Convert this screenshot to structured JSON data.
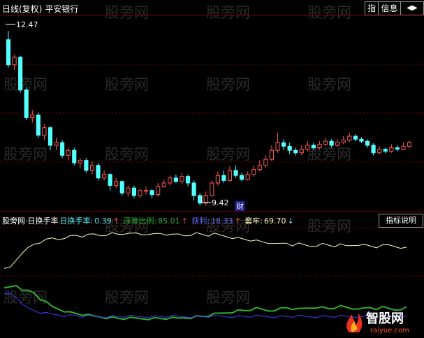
{
  "header": {
    "period": "日线(复权)",
    "stock": "平安银行",
    "btn_zhi": "指",
    "btn_info": "信息",
    "btn_arrows": "◀▶"
  },
  "watermark": "股旁网",
  "price_labels": {
    "high": "12.47",
    "low": "9.42"
  },
  "event_marker": "财",
  "indicator": {
    "name": "股旁网·日换手率",
    "turnover_label": "日换手率:",
    "turnover_value": "0.39",
    "float_label": "浮筹比例:",
    "float_value": "85.01",
    "profit_label": "获利:",
    "profit_value": "18.33",
    "trapped_label": "套牢:",
    "trapped_value": "69.70",
    "desc_button": "指标说明"
  },
  "colors": {
    "up": "#ff5a5a",
    "down": "#54ffff",
    "yellow": "#fffcbf",
    "green": "#2fae2f",
    "blue": "#3d3dff",
    "grid": "#7a0000",
    "white": "#ffffff"
  },
  "logo": {
    "text": "智股网",
    "url": "raiyue.com"
  },
  "chart_data": [
    {
      "type": "candlestick",
      "labels": {
        "high": "12.47",
        "low": "9.42"
      },
      "ylim": [
        9.2,
        12.7
      ],
      "candles": [
        [
          12.3,
          11.8,
          12.47,
          11.75
        ],
        [
          11.8,
          11.95,
          12.0,
          11.7
        ],
        [
          11.95,
          11.3,
          11.98,
          11.25
        ],
        [
          11.3,
          10.75,
          11.35,
          10.7
        ],
        [
          10.75,
          10.8,
          10.9,
          10.65
        ],
        [
          10.8,
          10.4,
          10.85,
          10.35
        ],
        [
          10.4,
          10.55,
          10.62,
          10.3
        ],
        [
          10.55,
          10.2,
          10.58,
          10.1
        ],
        [
          10.2,
          10.25,
          10.35,
          10.1
        ],
        [
          10.25,
          10.0,
          10.3,
          9.95
        ],
        [
          10.0,
          10.1,
          10.15,
          9.9
        ],
        [
          10.1,
          9.85,
          10.15,
          9.8
        ],
        [
          9.85,
          9.9,
          9.95,
          9.75
        ],
        [
          9.9,
          9.7,
          9.95,
          9.65
        ],
        [
          9.7,
          9.8,
          9.88,
          9.62
        ],
        [
          9.8,
          9.55,
          9.85,
          9.5
        ],
        [
          9.55,
          9.62,
          9.7,
          9.5
        ],
        [
          9.62,
          9.4,
          9.65,
          9.3
        ],
        [
          9.4,
          9.48,
          9.55,
          9.35
        ],
        [
          9.48,
          9.25,
          9.5,
          9.2
        ],
        [
          9.25,
          9.35,
          9.4,
          9.18
        ],
        [
          9.35,
          9.2,
          9.4,
          9.15
        ],
        [
          9.2,
          9.3,
          9.35,
          9.15
        ],
        [
          9.3,
          9.3,
          9.38,
          9.22
        ],
        [
          9.3,
          9.22,
          9.33,
          9.15
        ],
        [
          9.22,
          9.38,
          9.45,
          9.18
        ],
        [
          9.38,
          9.45,
          9.52,
          9.35
        ],
        [
          9.45,
          9.55,
          9.6,
          9.4
        ],
        [
          9.55,
          9.48,
          9.62,
          9.45
        ],
        [
          9.48,
          9.58,
          9.65,
          9.42
        ],
        [
          9.58,
          9.45,
          9.62,
          9.38
        ],
        [
          9.45,
          9.2,
          9.5,
          9.1
        ],
        [
          9.2,
          9.05,
          9.25,
          9.0
        ],
        [
          9.05,
          9.2,
          9.28,
          9.0
        ],
        [
          9.2,
          9.45,
          9.5,
          9.18
        ],
        [
          9.45,
          9.6,
          9.68,
          9.4
        ],
        [
          9.6,
          9.5,
          9.7,
          9.45
        ],
        [
          9.5,
          9.7,
          9.78,
          9.48
        ],
        [
          9.7,
          9.6,
          9.8,
          9.55
        ],
        [
          9.6,
          9.52,
          9.65,
          9.48
        ],
        [
          9.52,
          9.62,
          9.68,
          9.5
        ],
        [
          9.62,
          9.72,
          9.8,
          9.58
        ],
        [
          9.72,
          9.8,
          9.9,
          9.68
        ],
        [
          9.8,
          9.92,
          10.0,
          9.75
        ],
        [
          9.92,
          10.1,
          10.2,
          9.88
        ],
        [
          10.1,
          10.25,
          10.45,
          10.05
        ],
        [
          10.25,
          10.18,
          10.32,
          10.1
        ],
        [
          10.18,
          10.1,
          10.25,
          10.02
        ],
        [
          10.1,
          10.05,
          10.15,
          10.0
        ],
        [
          10.05,
          10.12,
          10.2,
          10.0
        ],
        [
          10.12,
          10.2,
          10.28,
          10.08
        ],
        [
          10.2,
          10.15,
          10.25,
          10.1
        ],
        [
          10.15,
          10.22,
          10.28,
          10.12
        ],
        [
          10.22,
          10.28,
          10.35,
          10.18
        ],
        [
          10.28,
          10.2,
          10.32,
          10.15
        ],
        [
          10.2,
          10.26,
          10.32,
          10.16
        ],
        [
          10.26,
          10.3,
          10.38,
          10.22
        ],
        [
          10.3,
          10.38,
          10.45,
          10.26
        ],
        [
          10.38,
          10.32,
          10.42,
          10.28
        ],
        [
          10.32,
          10.28,
          10.36,
          10.24
        ],
        [
          10.28,
          10.2,
          10.32,
          10.15
        ],
        [
          10.2,
          10.05,
          10.24,
          10.0
        ],
        [
          10.05,
          10.12,
          10.18,
          10.02
        ],
        [
          10.12,
          10.08,
          10.15,
          10.04
        ],
        [
          10.08,
          10.15,
          10.22,
          10.05
        ],
        [
          10.15,
          10.12,
          10.2,
          10.08
        ],
        [
          10.12,
          10.18,
          10.26,
          10.1
        ],
        [
          10.18,
          10.25,
          10.3,
          10.15
        ]
      ]
    },
    {
      "type": "line",
      "series": [
        {
          "name": "浮筹比例",
          "color": "yellow",
          "values": [
            60,
            62,
            70,
            78,
            82,
            86,
            88,
            90,
            92,
            91,
            93,
            94,
            95,
            94,
            95,
            96,
            95,
            96,
            97,
            96,
            97,
            96,
            97,
            96,
            97,
            96,
            97,
            96,
            95,
            96,
            95,
            96,
            97,
            96,
            95,
            96,
            95,
            94,
            93,
            92,
            91,
            90,
            89,
            88,
            87,
            88,
            86,
            87,
            85,
            86,
            85,
            84,
            85,
            86,
            85,
            84,
            85,
            84,
            85,
            86,
            85,
            84,
            83,
            84,
            85,
            84,
            83,
            82
          ]
        },
        {
          "name": "获利",
          "color": "green",
          "values": [
            40,
            42,
            44,
            40,
            38,
            36,
            30,
            26,
            22,
            20,
            18,
            16,
            15,
            14,
            13,
            12,
            12,
            11,
            11,
            10,
            10,
            10,
            10,
            10,
            10,
            10,
            10,
            10,
            10,
            10,
            11,
            11,
            12,
            12,
            13,
            14,
            15,
            16,
            17,
            18,
            18,
            19,
            20,
            19,
            18,
            19,
            20,
            21,
            20,
            19,
            20,
            21,
            22,
            21,
            20,
            21,
            22,
            21,
            20,
            21,
            20,
            21,
            20,
            21,
            20,
            19,
            20,
            21
          ]
        },
        {
          "name": "套牢",
          "color": "blue",
          "values": [
            34,
            35,
            32,
            26,
            20,
            18,
            16,
            15,
            14,
            14,
            13,
            13,
            13,
            12,
            12,
            12,
            12,
            12,
            12,
            12,
            12,
            12,
            12,
            12,
            12,
            12,
            12,
            12,
            12,
            12,
            12,
            12,
            12,
            12,
            12,
            12,
            12,
            12,
            12,
            12,
            12,
            12,
            12,
            12,
            12,
            12,
            12,
            12,
            12,
            12,
            12,
            12,
            12,
            12,
            12,
            12,
            12,
            12,
            12,
            12,
            12,
            12,
            12,
            12,
            12,
            12,
            12,
            12
          ]
        }
      ]
    }
  ]
}
